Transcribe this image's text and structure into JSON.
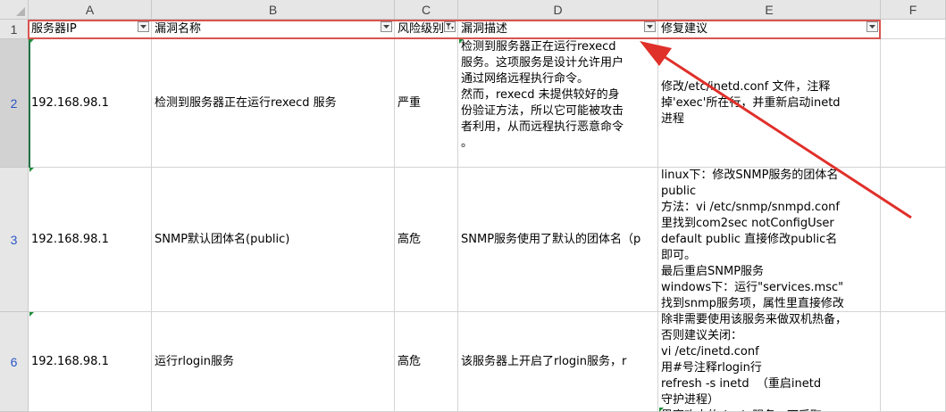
{
  "columns": [
    "A",
    "B",
    "C",
    "D",
    "E",
    "F"
  ],
  "header_row": {
    "number": "1",
    "cells": [
      "服务器IP",
      "漏洞名称",
      "风险级别",
      "漏洞描述",
      "修复建议"
    ]
  },
  "rows": [
    {
      "number": "2",
      "ip": "192.168.98.1",
      "name": "检测到服务器正在运行rexecd 服务",
      "risk": "严重",
      "description": "检测到服务器正在运行rexecd\n服务。这项服务是设计允许用户\n通过网络远程执行命令。\n然而，rexecd 未提供较好的身\n份验证方法，所以它可能被攻击\n者利用，从而远程执行恶意命令\n。",
      "fix": "修改/etc/inetd.conf 文件，注释\n掉'exec'所在行，并重新启动inetd\n进程"
    },
    {
      "number": "3",
      "ip": "192.168.98.1",
      "name": "SNMP默认团体名(public)",
      "risk": "高危",
      "description": "SNMP服务使用了默认的团体名（p",
      "fix": "linux下：修改SNMP服务的团体名\npublic\n方法：vi /etc/snmp/snmpd.conf\n里找到com2sec notConfigUser\ndefault public 直接修改public名\n即可。\n最后重启SNMP服务\nwindows下：运行\"services.msc\"\n找到snmp服务项，属性里直接修改"
    },
    {
      "number": "6",
      "ip": "192.168.98.1",
      "name": "运行rlogin服务",
      "risk": "高危",
      "description": "该服务器上开启了rlogin服务，r",
      "fix": "除非需要使用该服务来做双机热备，\n否则建议关闭：\nvi /etc/inetd.conf\n用#号注释rlogin行\nrefresh -s inetd  （重启inetd\n守护进程）\n黑客攻击的rlogin服务，可采取"
    }
  ],
  "colors": {
    "header_bg": "#e6e6e6",
    "row_link": "#2a56c6",
    "annotation_red": "#e0302a",
    "selection_green": "#217346"
  },
  "icons": [
    "filter-dropdown-icon",
    "filter-active-icon",
    "annotation-arrow"
  ]
}
